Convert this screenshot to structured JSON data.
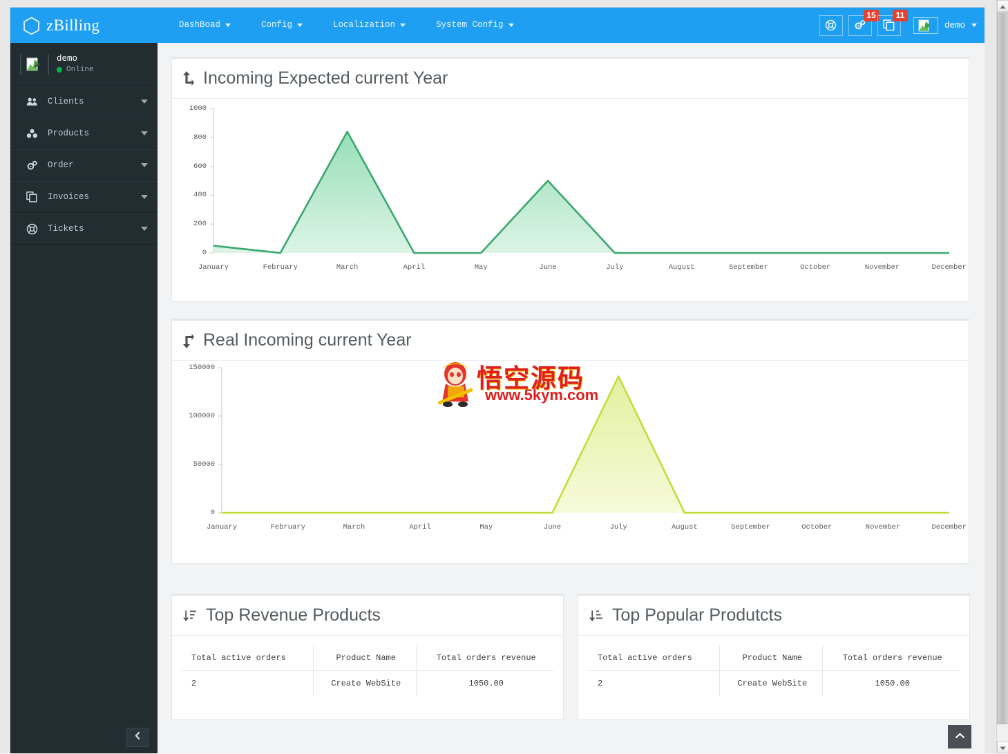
{
  "brand": {
    "name": "zBilling",
    "logo_icon": "hexagon-logo-icon"
  },
  "navbar": {
    "background": "#1e9ff2",
    "menu": [
      {
        "label": "DashBoad",
        "icon": "chevron-down-icon"
      },
      {
        "label": "Config",
        "icon": "chevron-down-icon"
      },
      {
        "label": "Localization",
        "icon": "chevron-down-icon"
      },
      {
        "label": "System Config",
        "icon": "chevron-down-icon"
      }
    ],
    "actions": [
      {
        "name": "support-button",
        "icon": "life-ring-icon",
        "badge": ""
      },
      {
        "name": "settings-button",
        "icon": "gears-icon",
        "badge": "15"
      },
      {
        "name": "invoices-button",
        "icon": "copy-icon",
        "badge": "11"
      }
    ],
    "badge_color": "#e7412e",
    "user": {
      "label": "demo",
      "avatar_icon": "image-placeholder-icon",
      "caret_icon": "chevron-down-icon"
    }
  },
  "sidebar": {
    "background": "#222d32",
    "user": {
      "name": "demo",
      "status": "Online",
      "status_color": "#00b84a",
      "avatar_icon": "image-placeholder-icon"
    },
    "items": [
      {
        "label": "Clients",
        "icon": "users-icon",
        "caret": "chevron-down-icon"
      },
      {
        "label": "Products",
        "icon": "cubes-icon",
        "caret": "chevron-down-icon"
      },
      {
        "label": "Order",
        "icon": "gears-icon",
        "caret": "chevron-down-icon"
      },
      {
        "label": "Invoices",
        "icon": "copy-icon",
        "caret": "chevron-down-icon"
      },
      {
        "label": "Tickets",
        "icon": "life-ring-icon",
        "caret": "chevron-down-icon"
      }
    ],
    "collapse_button": {
      "name": "sidebar-collapse-button",
      "icon": "chevron-left-icon"
    }
  },
  "cards": {
    "incoming_expected": {
      "title": "Incoming Expected current Year",
      "icon": "arrow-up-level-icon"
    },
    "real_incoming": {
      "title": "Real Incoming current Year",
      "icon": "arrow-down-level-icon"
    },
    "top_revenue": {
      "title": "Top Revenue Products",
      "icon": "sort-amount-desc-icon"
    },
    "top_popular": {
      "title": "Top Popular Produtcts",
      "icon": "sort-amount-asc-icon"
    }
  },
  "tables": {
    "headers": [
      "Total active orders",
      "Product Name",
      "Total orders revenue"
    ],
    "top_revenue_rows": [
      {
        "orders": "2",
        "product": "Create WebSite",
        "revenue": "1050.00"
      }
    ],
    "top_popular_rows": [
      {
        "orders": "2",
        "product": "Create WebSite",
        "revenue": "1050.00"
      }
    ]
  },
  "watermark": {
    "cn": "悟空源码",
    "url": "www.5kym.com"
  },
  "scroll_top_button": {
    "name": "scroll-to-top-button",
    "icon": "chevron-up-icon"
  },
  "chart_data": [
    {
      "type": "area",
      "title": "Incoming Expected current Year",
      "categories": [
        "January",
        "February",
        "March",
        "April",
        "May",
        "June",
        "July",
        "August",
        "September",
        "October",
        "November",
        "December"
      ],
      "values": [
        50,
        0,
        840,
        0,
        0,
        500,
        0,
        0,
        0,
        0,
        0,
        0
      ],
      "ylim": [
        0,
        1000
      ],
      "yticks": [
        0,
        200,
        400,
        600,
        800,
        1000
      ],
      "xlabel": "",
      "ylabel": "",
      "grid": false,
      "legend": "none",
      "line_color": "#3aa76d",
      "fill_color": "#a9e3c3"
    },
    {
      "type": "area",
      "title": "Real Incoming current Year",
      "categories": [
        "January",
        "February",
        "March",
        "April",
        "May",
        "June",
        "July",
        "August",
        "September",
        "October",
        "November",
        "December"
      ],
      "values": [
        0,
        0,
        0,
        0,
        0,
        0,
        141000,
        0,
        0,
        0,
        0,
        0
      ],
      "ylim": [
        0,
        150000
      ],
      "yticks": [
        0,
        50000,
        100000,
        150000
      ],
      "xlabel": "",
      "ylabel": "",
      "grid": false,
      "legend": "none",
      "line_color": "#bfdb34",
      "fill_color": "#eef5c0"
    }
  ]
}
